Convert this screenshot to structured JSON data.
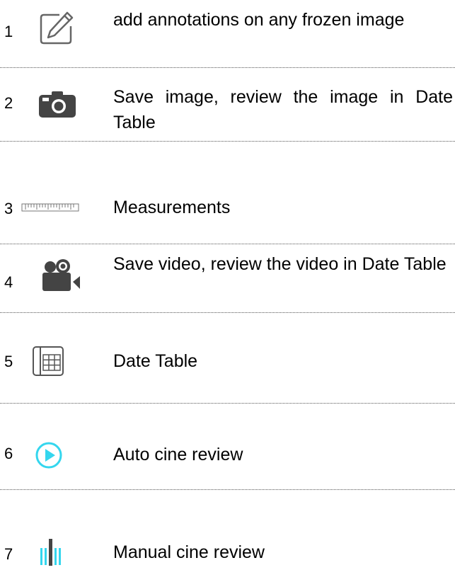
{
  "colors": {
    "icon_gray": "#666666",
    "icon_dark": "#444444",
    "icon_cyan": "#34d6ee",
    "separator": "#555555"
  },
  "rows": [
    {
      "number": "1",
      "icon": "edit-annotation-icon",
      "description": "add annotations on any frozen image"
    },
    {
      "number": "2",
      "icon": "camera-icon",
      "description": "Save image, review the image in Date Table"
    },
    {
      "number": "3",
      "icon": "ruler-icon",
      "description": "Measurements"
    },
    {
      "number": "4",
      "icon": "video-camera-icon",
      "description": "Save video, review the video in Date Table"
    },
    {
      "number": "5",
      "icon": "table-grid-icon",
      "description": "Date Table"
    },
    {
      "number": "6",
      "icon": "play-circle-icon",
      "description": "Auto cine review"
    },
    {
      "number": "7",
      "icon": "cine-slider-icon",
      "description": "Manual cine review"
    }
  ]
}
